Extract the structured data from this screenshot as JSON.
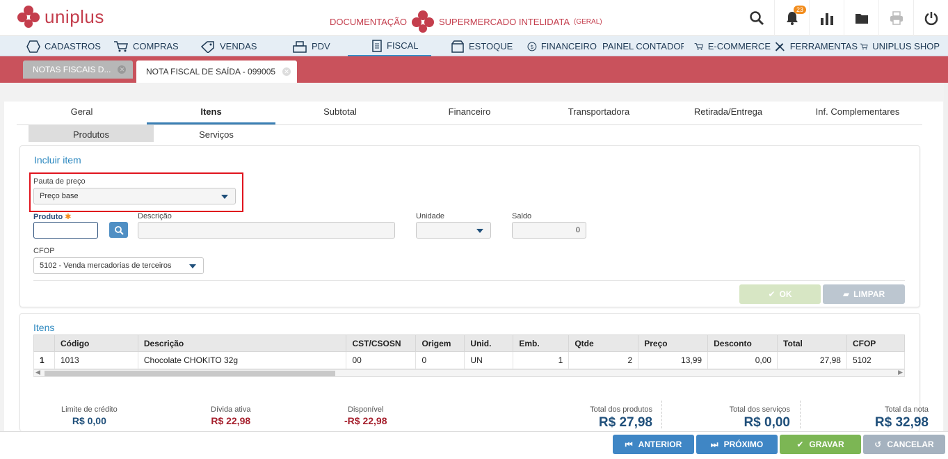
{
  "app": {
    "brand": "uniplus",
    "context_label": "DOCUMENTAÇÃO",
    "company": "SUPERMERCADO INTELIDATA",
    "company_scope": "(GERAL)",
    "notifications_count": "23",
    "accent_color": "#c43e4d"
  },
  "top_icons": [
    "search-icon",
    "bell-icon",
    "bar-chart-icon",
    "folder-icon",
    "printer-icon",
    "power-icon"
  ],
  "menu": [
    {
      "label": "CADASTROS",
      "icon": "hexagon-icon"
    },
    {
      "label": "COMPRAS",
      "icon": "cart-icon"
    },
    {
      "label": "VENDAS",
      "icon": "tag-icon"
    },
    {
      "label": "PDV",
      "icon": "register-icon"
    },
    {
      "label": "FISCAL",
      "icon": "document-icon"
    },
    {
      "label": "ESTOQUE",
      "icon": "box-icon"
    },
    {
      "label": "FINANCEIRO",
      "icon": "dollar-icon"
    },
    {
      "label": "PAINEL CONTADOR",
      "icon": "monitor-icon"
    },
    {
      "label": "E-COMMERCE",
      "icon": "cart-icon"
    },
    {
      "label": "FERRAMENTAS",
      "icon": "tools-icon"
    },
    {
      "label": "UNIPLUS SHOP",
      "icon": "cart-icon"
    }
  ],
  "doc_tabs": [
    {
      "label": "NOTAS FISCAIS D..."
    },
    {
      "label": "NOTA FISCAL DE SAÍDA - 099005"
    }
  ],
  "section_tabs": [
    "Geral",
    "Itens",
    "Subtotal",
    "Financeiro",
    "Transportadora",
    "Retirada/Entrega",
    "Inf. Complementares"
  ],
  "sub_tabs": [
    "Produtos",
    "Serviços"
  ],
  "form": {
    "title": "Incluir item",
    "pauta_label": "Pauta de preço",
    "pauta_value": "Preço base",
    "produto_label": "Produto",
    "produto_value": "",
    "descricao_label": "Descrição",
    "descricao_value": "",
    "unidade_label": "Unidade",
    "unidade_value": "",
    "saldo_label": "Saldo",
    "saldo_value": "0",
    "cfop_label": "CFOP",
    "cfop_value": "5102 - Venda mercadorias de terceiros",
    "ok_label": "OK",
    "limpar_label": "LIMPAR"
  },
  "items": {
    "title": "Itens",
    "columns": [
      "",
      "Código",
      "Descrição",
      "CST/CSOSN",
      "Origem",
      "Unid.",
      "Emb.",
      "Qtde",
      "Preço",
      "Desconto",
      "Total",
      "CFOP"
    ],
    "rows": [
      [
        "1",
        "1013",
        "Chocolate CHOKITO 32g",
        "00",
        "0",
        "UN",
        "1",
        "2",
        "13,99",
        "0,00",
        "27,98",
        "5102"
      ]
    ]
  },
  "summary": {
    "limite_label": "Limite de crédito",
    "limite_value": "R$ 0,00",
    "divida_label": "Dívida ativa",
    "divida_value": "R$ 22,98",
    "disponivel_label": "Disponível",
    "disponivel_value": "-R$ 22,98",
    "total_produtos_label": "Total dos produtos",
    "total_produtos_value": "R$ 27,98",
    "total_servicos_label": "Total dos serviços",
    "total_servicos_value": "R$ 0,00",
    "total_nota_label": "Total da nota",
    "total_nota_value": "R$ 32,98"
  },
  "footer": {
    "anterior": "ANTERIOR",
    "proximo": "PRÓXIMO",
    "gravar": "GRAVAR",
    "cancelar": "CANCELAR"
  }
}
